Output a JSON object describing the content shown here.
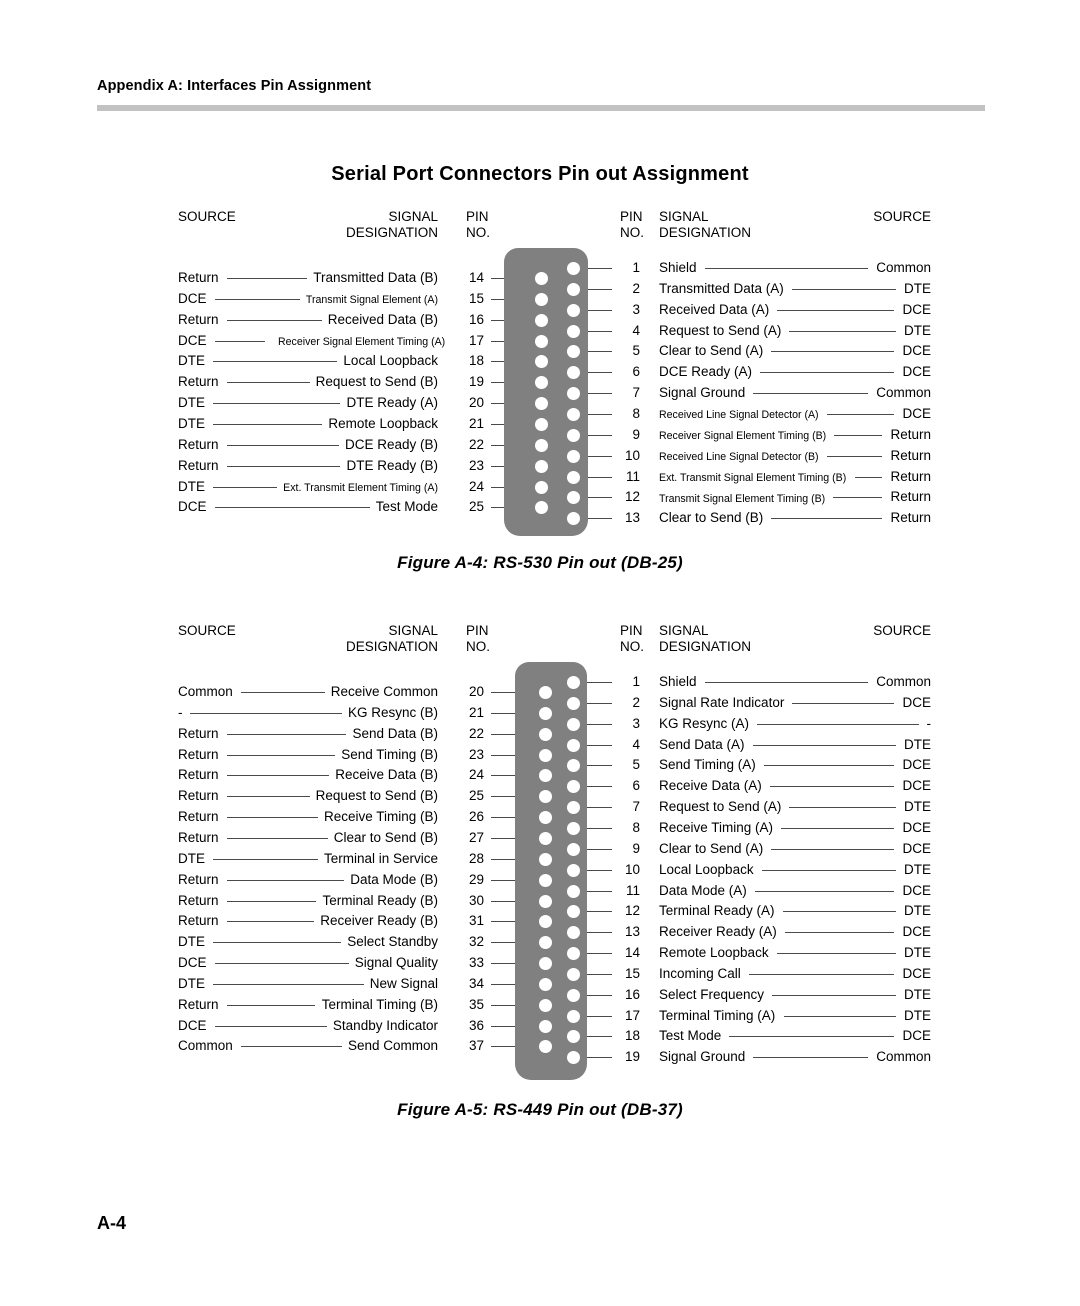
{
  "page": {
    "running_head": "Appendix A: Interfaces Pin Assignment",
    "section_title": "Serial Port Connectors Pin out Assignment",
    "folio": "A-4",
    "rule_color": "#c2c2c2",
    "connector_color": "#808080",
    "pin_color": "#ffffff",
    "leader_color": "#4a4a4a"
  },
  "column_headers": {
    "source": "SOURCE",
    "signal_line1": "SIGNAL",
    "signal_line2": "DESIGNATION",
    "pin_line1": "PIN",
    "pin_line2": "NO."
  },
  "figures": [
    {
      "id": "rs530",
      "caption": "Figure A-4: RS-530 Pin out (DB-25)",
      "connector": "DB-25",
      "left_rows": [
        {
          "source": "Return",
          "signal": "Transmitted Data (B)",
          "pin": "14",
          "small": false
        },
        {
          "source": "DCE",
          "signal": "Transmit Signal Element (A)",
          "pin": "15",
          "small": true
        },
        {
          "source": "Return",
          "signal": "Received Data (B)",
          "pin": "16",
          "small": false
        },
        {
          "source": "DCE",
          "signal": "Receiver Signal Element Timing (A)",
          "pin": "17",
          "small": true
        },
        {
          "source": "DTE",
          "signal": "Local Loopback",
          "pin": "18",
          "small": false
        },
        {
          "source": "Return",
          "signal": "Request to Send (B)",
          "pin": "19",
          "small": false
        },
        {
          "source": "DTE",
          "signal": "DTE Ready (A)",
          "pin": "20",
          "small": false
        },
        {
          "source": "DTE",
          "signal": "Remote Loopback",
          "pin": "21",
          "small": false
        },
        {
          "source": "Return",
          "signal": "DCE Ready (B)",
          "pin": "22",
          "small": false
        },
        {
          "source": "Return",
          "signal": "DTE Ready (B)",
          "pin": "23",
          "small": false
        },
        {
          "source": "DTE",
          "signal": "Ext. Transmit Element Timing (A)",
          "pin": "24",
          "small": true
        },
        {
          "source": "DCE",
          "signal": "Test Mode",
          "pin": "25",
          "small": false
        }
      ],
      "right_rows": [
        {
          "pin": "1",
          "signal": "Shield",
          "source": "Common",
          "small": false
        },
        {
          "pin": "2",
          "signal": "Transmitted Data (A)",
          "source": "DTE",
          "small": false
        },
        {
          "pin": "3",
          "signal": "Received Data (A)",
          "source": "DCE",
          "small": false
        },
        {
          "pin": "4",
          "signal": "Request to Send (A)",
          "source": "DTE",
          "small": false
        },
        {
          "pin": "5",
          "signal": "Clear to Send (A)",
          "source": "DCE",
          "small": false
        },
        {
          "pin": "6",
          "signal": "DCE Ready (A)",
          "source": "DCE",
          "small": false
        },
        {
          "pin": "7",
          "signal": "Signal Ground",
          "source": "Common",
          "small": false
        },
        {
          "pin": "8",
          "signal": "Received Line Signal Detector (A)",
          "source": "DCE",
          "small": true
        },
        {
          "pin": "9",
          "signal": "Receiver Signal Element Timing (B)",
          "source": "Return",
          "small": true
        },
        {
          "pin": "10",
          "signal": "Received Line Signal Detector (B)",
          "source": "Return",
          "small": true
        },
        {
          "pin": "11",
          "signal": "Ext. Transmit Signal Element Timing (B)",
          "source": "Return",
          "small": true
        },
        {
          "pin": "12",
          "signal": "Transmit Signal Element Timing (B)",
          "source": "Return",
          "small": true
        },
        {
          "pin": "13",
          "signal": "Clear to Send (B)",
          "source": "Return",
          "small": false
        }
      ]
    },
    {
      "id": "rs449",
      "caption": "Figure A-5: RS-449 Pin out (DB-37)",
      "connector": "DB-37",
      "left_rows": [
        {
          "source": "Common",
          "signal": "Receive Common",
          "pin": "20",
          "small": false
        },
        {
          "source": "-",
          "signal": "KG Resync (B)",
          "pin": "21",
          "small": false
        },
        {
          "source": "Return",
          "signal": "Send Data (B)",
          "pin": "22",
          "small": false
        },
        {
          "source": "Return",
          "signal": "Send Timing (B)",
          "pin": "23",
          "small": false
        },
        {
          "source": "Return",
          "signal": "Receive Data (B)",
          "pin": "24",
          "small": false
        },
        {
          "source": "Return",
          "signal": "Request to Send (B)",
          "pin": "25",
          "small": false
        },
        {
          "source": "Return",
          "signal": "Receive Timing (B)",
          "pin": "26",
          "small": false
        },
        {
          "source": "Return",
          "signal": "Clear to Send (B)",
          "pin": "27",
          "small": false
        },
        {
          "source": "DTE",
          "signal": "Terminal in Service",
          "pin": "28",
          "small": false
        },
        {
          "source": "Return",
          "signal": "Data Mode (B)",
          "pin": "29",
          "small": false
        },
        {
          "source": "Return",
          "signal": "Terminal Ready (B)",
          "pin": "30",
          "small": false
        },
        {
          "source": "Return",
          "signal": "Receiver Ready (B)",
          "pin": "31",
          "small": false
        },
        {
          "source": "DTE",
          "signal": "Select Standby",
          "pin": "32",
          "small": false
        },
        {
          "source": "DCE",
          "signal": "Signal Quality",
          "pin": "33",
          "small": false
        },
        {
          "source": "DTE",
          "signal": "New Signal",
          "pin": "34",
          "small": false
        },
        {
          "source": "Return",
          "signal": "Terminal Timing (B)",
          "pin": "35",
          "small": false
        },
        {
          "source": "DCE",
          "signal": "Standby Indicator",
          "pin": "36",
          "small": false
        },
        {
          "source": "Common",
          "signal": "Send Common",
          "pin": "37",
          "small": false
        }
      ],
      "right_rows": [
        {
          "pin": "1",
          "signal": "Shield",
          "source": "Common",
          "small": false
        },
        {
          "pin": "2",
          "signal": "Signal Rate Indicator",
          "source": "DCE",
          "small": false
        },
        {
          "pin": "3",
          "signal": "KG Resync (A)",
          "source": "-",
          "small": false
        },
        {
          "pin": "4",
          "signal": "Send Data (A)",
          "source": "DTE",
          "small": false
        },
        {
          "pin": "5",
          "signal": "Send Timing (A)",
          "source": "DCE",
          "small": false
        },
        {
          "pin": "6",
          "signal": "Receive Data (A)",
          "source": "DCE",
          "small": false
        },
        {
          "pin": "7",
          "signal": "Request to Send (A)",
          "source": "DTE",
          "small": false
        },
        {
          "pin": "8",
          "signal": "Receive Timing (A)",
          "source": "DCE",
          "small": false
        },
        {
          "pin": "9",
          "signal": "Clear to Send (A)",
          "source": "DCE",
          "small": false
        },
        {
          "pin": "10",
          "signal": "Local Loopback",
          "source": "DTE",
          "small": false
        },
        {
          "pin": "11",
          "signal": "Data Mode (A)",
          "source": "DCE",
          "small": false
        },
        {
          "pin": "12",
          "signal": "Terminal Ready (A)",
          "source": "DTE",
          "small": false
        },
        {
          "pin": "13",
          "signal": "Receiver Ready (A)",
          "source": "DCE",
          "small": false
        },
        {
          "pin": "14",
          "signal": "Remote Loopback",
          "source": "DTE",
          "small": false
        },
        {
          "pin": "15",
          "signal": "Incoming Call",
          "source": "DCE",
          "small": false
        },
        {
          "pin": "16",
          "signal": "Select Frequency",
          "source": "DTE",
          "small": false
        },
        {
          "pin": "17",
          "signal": "Terminal Timing (A)",
          "source": "DTE",
          "small": false
        },
        {
          "pin": "18",
          "signal": "Test Mode",
          "source": "DCE",
          "small": false
        },
        {
          "pin": "19",
          "signal": "Signal Ground",
          "source": "Common",
          "small": false
        }
      ]
    }
  ]
}
